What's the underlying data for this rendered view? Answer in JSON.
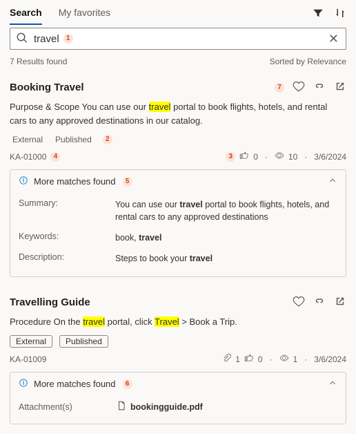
{
  "tabs": {
    "items": [
      "Search",
      "My favorites"
    ],
    "active": 0
  },
  "search": {
    "value": "travel",
    "badge_in_input": "1"
  },
  "meta": {
    "count_text": "7 Results found",
    "sort_text": "Sorted by Relevance"
  },
  "results": [
    {
      "title": "Booking Travel",
      "title_badge": "7",
      "snippet_pre": "Purpose & Scope You can use our ",
      "snippet_hl": "travel",
      "snippet_post": " portal to book flights, hotels, and rental cars to any approved destinations in our catalog.",
      "tags": [
        "External",
        "Published"
      ],
      "tags_badge": "2",
      "id": "KA-01000",
      "id_badge": "4",
      "stats": {
        "likes": "0",
        "views": "10",
        "date": "3/6/2024",
        "stats_badge": "3"
      },
      "expander": {
        "label": "More matches found",
        "label_badge": "5",
        "rows": {
          "summary_k": "Summary:",
          "summary_v_pre": "You can use our ",
          "summary_v_b1": "travel",
          "summary_v_mid": " portal to book flights, hotels, and rental cars to any approved destinations",
          "keywords_k": "Keywords:",
          "keywords_v_pre": "book, ",
          "keywords_v_b": "travel",
          "desc_k": "Description:",
          "desc_v_pre": "Steps to book your ",
          "desc_v_b": "travel"
        }
      }
    },
    {
      "title": "Travelling Guide",
      "snippet_pre": "Procedure On the ",
      "snippet_hl1": "travel",
      "snippet_mid": " portal, click ",
      "snippet_hl2": "Travel",
      "snippet_post": " > Book a Trip.",
      "tags": [
        "External",
        "Published"
      ],
      "id": "KA-01009",
      "stats": {
        "attach": "1",
        "likes": "0",
        "views": "1",
        "date": "3/6/2024"
      },
      "expander": {
        "label": "More matches found",
        "label_badge": "6",
        "attach_k": "Attachment(s)",
        "attach_v": "bookingguide.pdf"
      }
    }
  ]
}
